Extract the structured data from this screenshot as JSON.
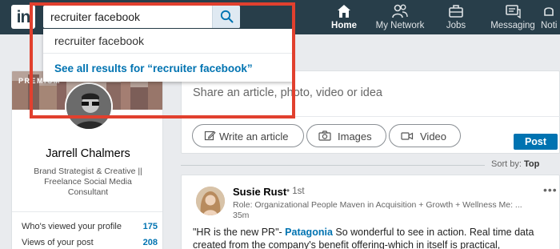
{
  "app": {
    "logo": "in",
    "colors": {
      "nav_bg": "#283e4a",
      "accent": "#0073b1",
      "highlight": "#e1402e"
    }
  },
  "search": {
    "value": "recruiter facebook",
    "suggestion": "recruiter facebook",
    "see_all": "See all results for “recruiter facebook”"
  },
  "nav": {
    "items": [
      {
        "label": "Home",
        "icon": "home-icon"
      },
      {
        "label": "My Network",
        "icon": "people-icon"
      },
      {
        "label": "Jobs",
        "icon": "briefcase-icon"
      },
      {
        "label": "Messaging",
        "icon": "chat-icon"
      },
      {
        "label": "Noti",
        "icon": "bell-icon"
      }
    ]
  },
  "profile": {
    "badge": "PREMIUM",
    "name": "Jarrell Chalmers",
    "headline": "Brand Strategist & Creative || Freelance Social Media Consultant",
    "stats": [
      {
        "label": "Who's viewed your profile",
        "value": "175"
      },
      {
        "label": "Views of your post",
        "value": "208"
      }
    ]
  },
  "share": {
    "prompt": "Share an article, photo, video or idea",
    "buttons": [
      {
        "label": "Write an article",
        "icon": "pencil-icon"
      },
      {
        "label": "Images",
        "icon": "camera-icon"
      },
      {
        "label": "Video",
        "icon": "video-icon"
      }
    ],
    "post_label": "Post"
  },
  "feed": {
    "sort_label": "Sort by:",
    "sort_value": "Top",
    "post": {
      "author": "Susie Rust",
      "degree": "• 1st",
      "role": "Role: Organizational People Maven in Acquisition + Growth + Wellness Me: ...",
      "time": "35m",
      "more": "•••",
      "body_prefix": "\"HR is the new PR\"- ",
      "mention": "Patagonia",
      "body_suffix": " So wonderful to see in action. Real time data",
      "body_line2": "created from the company's benefit offering-which in itself is practical,"
    }
  }
}
